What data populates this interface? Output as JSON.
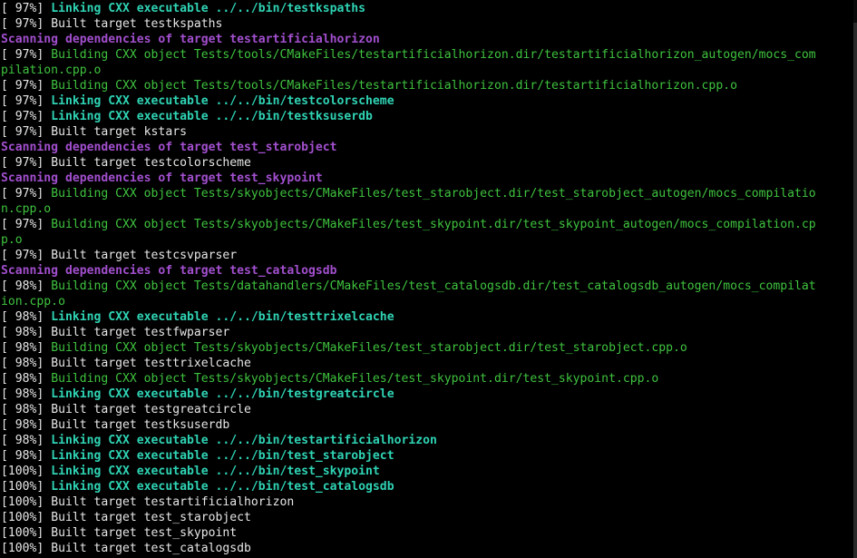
{
  "colors": {
    "background": "#000000",
    "default_text": "#e6e6e6",
    "linking": "#2fd3b4",
    "building": "#3fc33f",
    "scanning": "#a24fce"
  },
  "lines": [
    {
      "pct": "[ 97%] ",
      "text": "Linking CXX executable ../../bin/testkspaths",
      "kind": "link"
    },
    {
      "pct": "[ 97%] ",
      "text": "Built target testkspaths",
      "kind": "built"
    },
    {
      "pct": "",
      "text": "Scanning dependencies of target testartificialhorizon",
      "kind": "scan"
    },
    {
      "pct": "[ 97%] ",
      "text": "Building CXX object Tests/tools/CMakeFiles/testartificialhorizon.dir/testartificialhorizon_autogen/mocs_com",
      "kind": "build"
    },
    {
      "pct": "",
      "text": "pilation.cpp.o",
      "kind": "build"
    },
    {
      "pct": "[ 97%] ",
      "text": "Building CXX object Tests/tools/CMakeFiles/testartificialhorizon.dir/testartificialhorizon.cpp.o",
      "kind": "build"
    },
    {
      "pct": "[ 97%] ",
      "text": "Linking CXX executable ../../bin/testcolorscheme",
      "kind": "link"
    },
    {
      "pct": "[ 97%] ",
      "text": "Linking CXX executable ../../bin/testksuserdb",
      "kind": "link"
    },
    {
      "pct": "[ 97%] ",
      "text": "Built target kstars",
      "kind": "built"
    },
    {
      "pct": "",
      "text": "Scanning dependencies of target test_starobject",
      "kind": "scan"
    },
    {
      "pct": "[ 97%] ",
      "text": "Built target testcolorscheme",
      "kind": "built"
    },
    {
      "pct": "",
      "text": "Scanning dependencies of target test_skypoint",
      "kind": "scan"
    },
    {
      "pct": "[ 97%] ",
      "text": "Building CXX object Tests/skyobjects/CMakeFiles/test_starobject.dir/test_starobject_autogen/mocs_compilatio",
      "kind": "build"
    },
    {
      "pct": "",
      "text": "n.cpp.o",
      "kind": "build"
    },
    {
      "pct": "[ 97%] ",
      "text": "Building CXX object Tests/skyobjects/CMakeFiles/test_skypoint.dir/test_skypoint_autogen/mocs_compilation.cp",
      "kind": "build"
    },
    {
      "pct": "",
      "text": "p.o",
      "kind": "build"
    },
    {
      "pct": "[ 97%] ",
      "text": "Built target testcsvparser",
      "kind": "built"
    },
    {
      "pct": "",
      "text": "Scanning dependencies of target test_catalogsdb",
      "kind": "scan"
    },
    {
      "pct": "[ 98%] ",
      "text": "Building CXX object Tests/datahandlers/CMakeFiles/test_catalogsdb.dir/test_catalogsdb_autogen/mocs_compilat",
      "kind": "build"
    },
    {
      "pct": "",
      "text": "ion.cpp.o",
      "kind": "build"
    },
    {
      "pct": "[ 98%] ",
      "text": "Linking CXX executable ../../bin/testtrixelcache",
      "kind": "link"
    },
    {
      "pct": "[ 98%] ",
      "text": "Built target testfwparser",
      "kind": "built"
    },
    {
      "pct": "[ 98%] ",
      "text": "Building CXX object Tests/skyobjects/CMakeFiles/test_starobject.dir/test_starobject.cpp.o",
      "kind": "build"
    },
    {
      "pct": "[ 98%] ",
      "text": "Built target testtrixelcache",
      "kind": "built"
    },
    {
      "pct": "[ 98%] ",
      "text": "Building CXX object Tests/skyobjects/CMakeFiles/test_skypoint.dir/test_skypoint.cpp.o",
      "kind": "build"
    },
    {
      "pct": "[ 98%] ",
      "text": "Linking CXX executable ../../bin/testgreatcircle",
      "kind": "link"
    },
    {
      "pct": "[ 98%] ",
      "text": "Built target testgreatcircle",
      "kind": "built"
    },
    {
      "pct": "[ 98%] ",
      "text": "Built target testksuserdb",
      "kind": "built"
    },
    {
      "pct": "[ 98%] ",
      "text": "Linking CXX executable ../../bin/testartificialhorizon",
      "kind": "link"
    },
    {
      "pct": "[ 98%] ",
      "text": "Linking CXX executable ../../bin/test_starobject",
      "kind": "link"
    },
    {
      "pct": "[100%] ",
      "text": "Linking CXX executable ../../bin/test_skypoint",
      "kind": "link"
    },
    {
      "pct": "[100%] ",
      "text": "Linking CXX executable ../../bin/test_catalogsdb",
      "kind": "link"
    },
    {
      "pct": "[100%] ",
      "text": "Built target testartificialhorizon",
      "kind": "built"
    },
    {
      "pct": "[100%] ",
      "text": "Built target test_starobject",
      "kind": "built"
    },
    {
      "pct": "[100%] ",
      "text": "Built target test_skypoint",
      "kind": "built"
    },
    {
      "pct": "[100%] ",
      "text": "Built target test_catalogsdb",
      "kind": "built"
    }
  ]
}
